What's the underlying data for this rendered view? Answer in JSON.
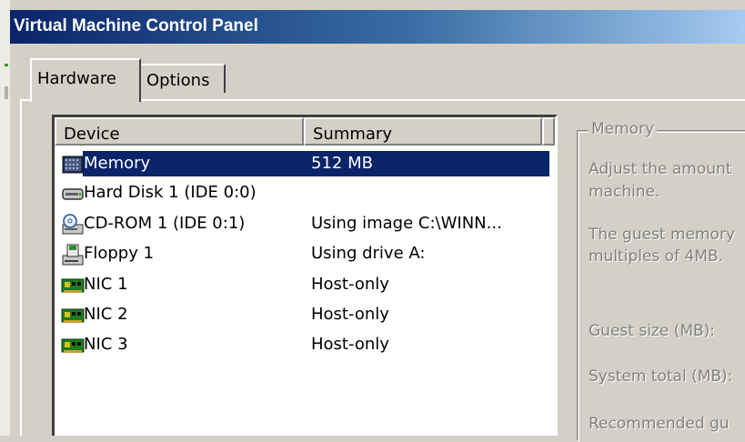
{
  "window": {
    "title": "Virtual Machine Control Panel"
  },
  "tabs": {
    "hardware": "Hardware",
    "options": "Options"
  },
  "list": {
    "columns": {
      "device": "Device",
      "summary": "Summary"
    },
    "rows": [
      {
        "device": "Memory",
        "summary": "512 MB",
        "icon": "memory-icon",
        "selected": true
      },
      {
        "device": "Hard Disk 1 (IDE 0:0)",
        "summary": "",
        "icon": "hard-disk-icon",
        "selected": false
      },
      {
        "device": "CD-ROM 1 (IDE 0:1)",
        "summary": "Using image C:\\WINN...",
        "icon": "cdrom-icon",
        "selected": false
      },
      {
        "device": "Floppy 1",
        "summary": "Using drive A:",
        "icon": "floppy-icon",
        "selected": false
      },
      {
        "device": "NIC 1",
        "summary": "Host-only",
        "icon": "nic-icon",
        "selected": false
      },
      {
        "device": "NIC 2",
        "summary": "Host-only",
        "icon": "nic-icon",
        "selected": false
      },
      {
        "device": "NIC 3",
        "summary": "Host-only",
        "icon": "nic-icon",
        "selected": false
      }
    ]
  },
  "memory_group": {
    "legend": "Memory",
    "desc_line1": "Adjust the amount",
    "desc_line2": "machine.",
    "guest_line1": "The guest memory",
    "guest_line2": "multiples of 4MB.",
    "guest_size_label": "Guest size (MB):",
    "system_total_label": "System total (MB):",
    "recommended_label": "Recommended gu"
  },
  "colors": {
    "selection": "#0a246a",
    "face": "#d4d0c8",
    "disabled_text": "#808080"
  }
}
